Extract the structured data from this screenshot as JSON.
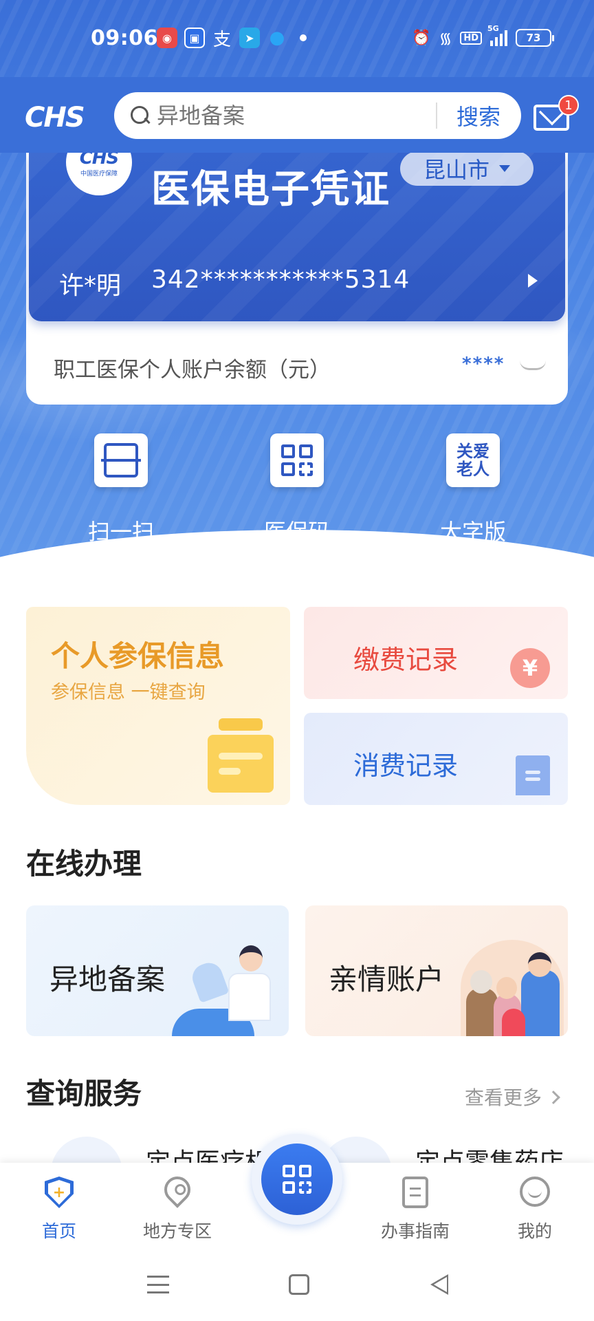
{
  "status_bar": {
    "time": "09:06",
    "battery": "73",
    "network": "5G",
    "hd": "HD",
    "alipay_glyph": "支"
  },
  "header": {
    "logo_text": "CHS",
    "search_placeholder": "异地备案",
    "search_button": "搜索",
    "mail_badge": "1"
  },
  "card": {
    "logo_mark": "CHS",
    "logo_sub": "中国医疗保障",
    "title": "医保电子凭证",
    "city": "昆山市",
    "holder_name": "许*明",
    "id_number": "342***********5314",
    "balance_label": "职工医保个人账户余额（元）",
    "balance_value": "****"
  },
  "quick_actions": [
    {
      "label": "扫一扫",
      "icon": "scan-icon"
    },
    {
      "label": "医保码",
      "icon": "qr-code-icon"
    },
    {
      "label": "大字版",
      "icon": "elder-care-icon",
      "icon_text": "关爱\n老人"
    }
  ],
  "features": {
    "personal": {
      "title": "个人参保信息",
      "subtitle": "参保信息 一键查询"
    },
    "payment": {
      "title": "缴费记录",
      "icon_text": "¥"
    },
    "spending": {
      "title": "消费记录"
    }
  },
  "online_section": {
    "title": "在线办理",
    "items": [
      {
        "label": "异地备案"
      },
      {
        "label": "亲情账户"
      }
    ]
  },
  "query_section": {
    "title": "查询服务",
    "more": "查看更多",
    "peek_left": "定点医疗机",
    "peek_right": "定点零售药店"
  },
  "bottom_nav": {
    "items": [
      {
        "label": "首页",
        "active": true
      },
      {
        "label": "地方专区"
      },
      {
        "label": "办事指南"
      },
      {
        "label": "我的"
      }
    ]
  },
  "colors": {
    "primary": "#3a6fd8",
    "accent_orange": "#e89a28",
    "accent_red": "#e84a3f",
    "accent_blue": "#2d6bd8"
  }
}
